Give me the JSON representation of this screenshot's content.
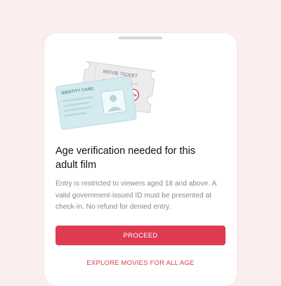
{
  "modal": {
    "title": "Age verification needed for this adult film",
    "body": "Entry is restricted to viewers aged 18 and above. A valid government-issued ID must be presented at check-in. No refund for denied entry.",
    "primary_button": "PROCEED",
    "secondary_button": "EXPLORE MOVIES FOR ALL AGE"
  },
  "illustration": {
    "ticket_label": "MOVIE TICKET",
    "card_label": "IDENTITY CARD",
    "age_badge": "18+"
  },
  "colors": {
    "accent": "#de3b51",
    "card": "#d3ebee",
    "ticket": "#ececec"
  }
}
